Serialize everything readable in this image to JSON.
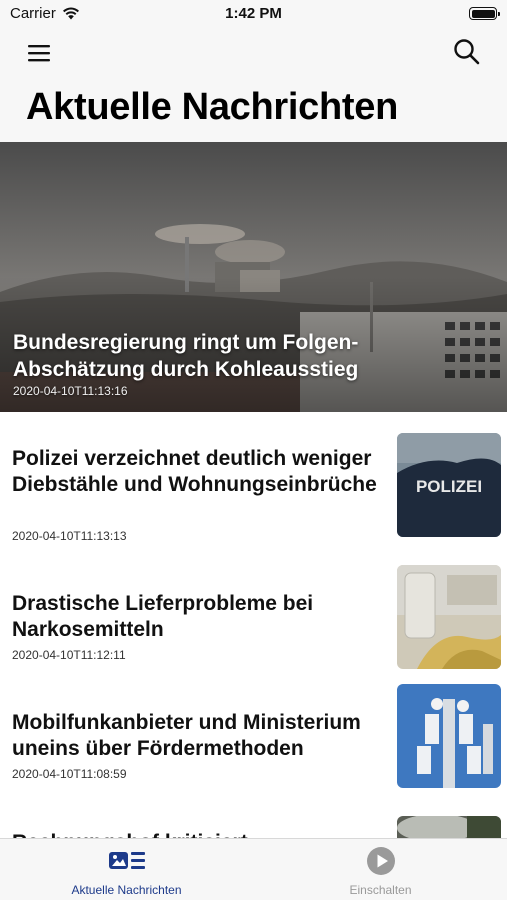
{
  "status_bar": {
    "carrier": "Carrier",
    "time": "1:42 PM"
  },
  "header": {
    "title": "Aktuelle Nachrichten",
    "menu_icon": "hamburger-menu-icon",
    "search_icon": "search-icon"
  },
  "hero": {
    "title": "Bundesregierung ringt um Folgen-Abschätzung durch Kohleausstieg",
    "date": "2020-04-10T11:13:16"
  },
  "articles": [
    {
      "title": "Polizei verzeichnet deutlich weniger Diebstähle und Wohnungseinbrüche",
      "date": "2020-04-10T11:13:13",
      "thumb_text": "POLIZEI"
    },
    {
      "title": "Drastische Lieferprobleme bei Narkosemitteln",
      "date": "2020-04-10T11:12:11"
    },
    {
      "title": "Mobilfunkanbieter und Ministerium uneins über Fördermethoden",
      "date": "2020-04-10T11:08:59"
    },
    {
      "title": "Rechnungshof kritisiert"
    }
  ],
  "tabs": [
    {
      "label": "Aktuelle Nachrichten",
      "icon": "news-icon",
      "active": true
    },
    {
      "label": "Einschalten",
      "icon": "play-icon",
      "active": false
    }
  ],
  "colors": {
    "accent": "#1d3a8a",
    "inactive": "#999999",
    "bar_background": "#f7f7f7"
  }
}
